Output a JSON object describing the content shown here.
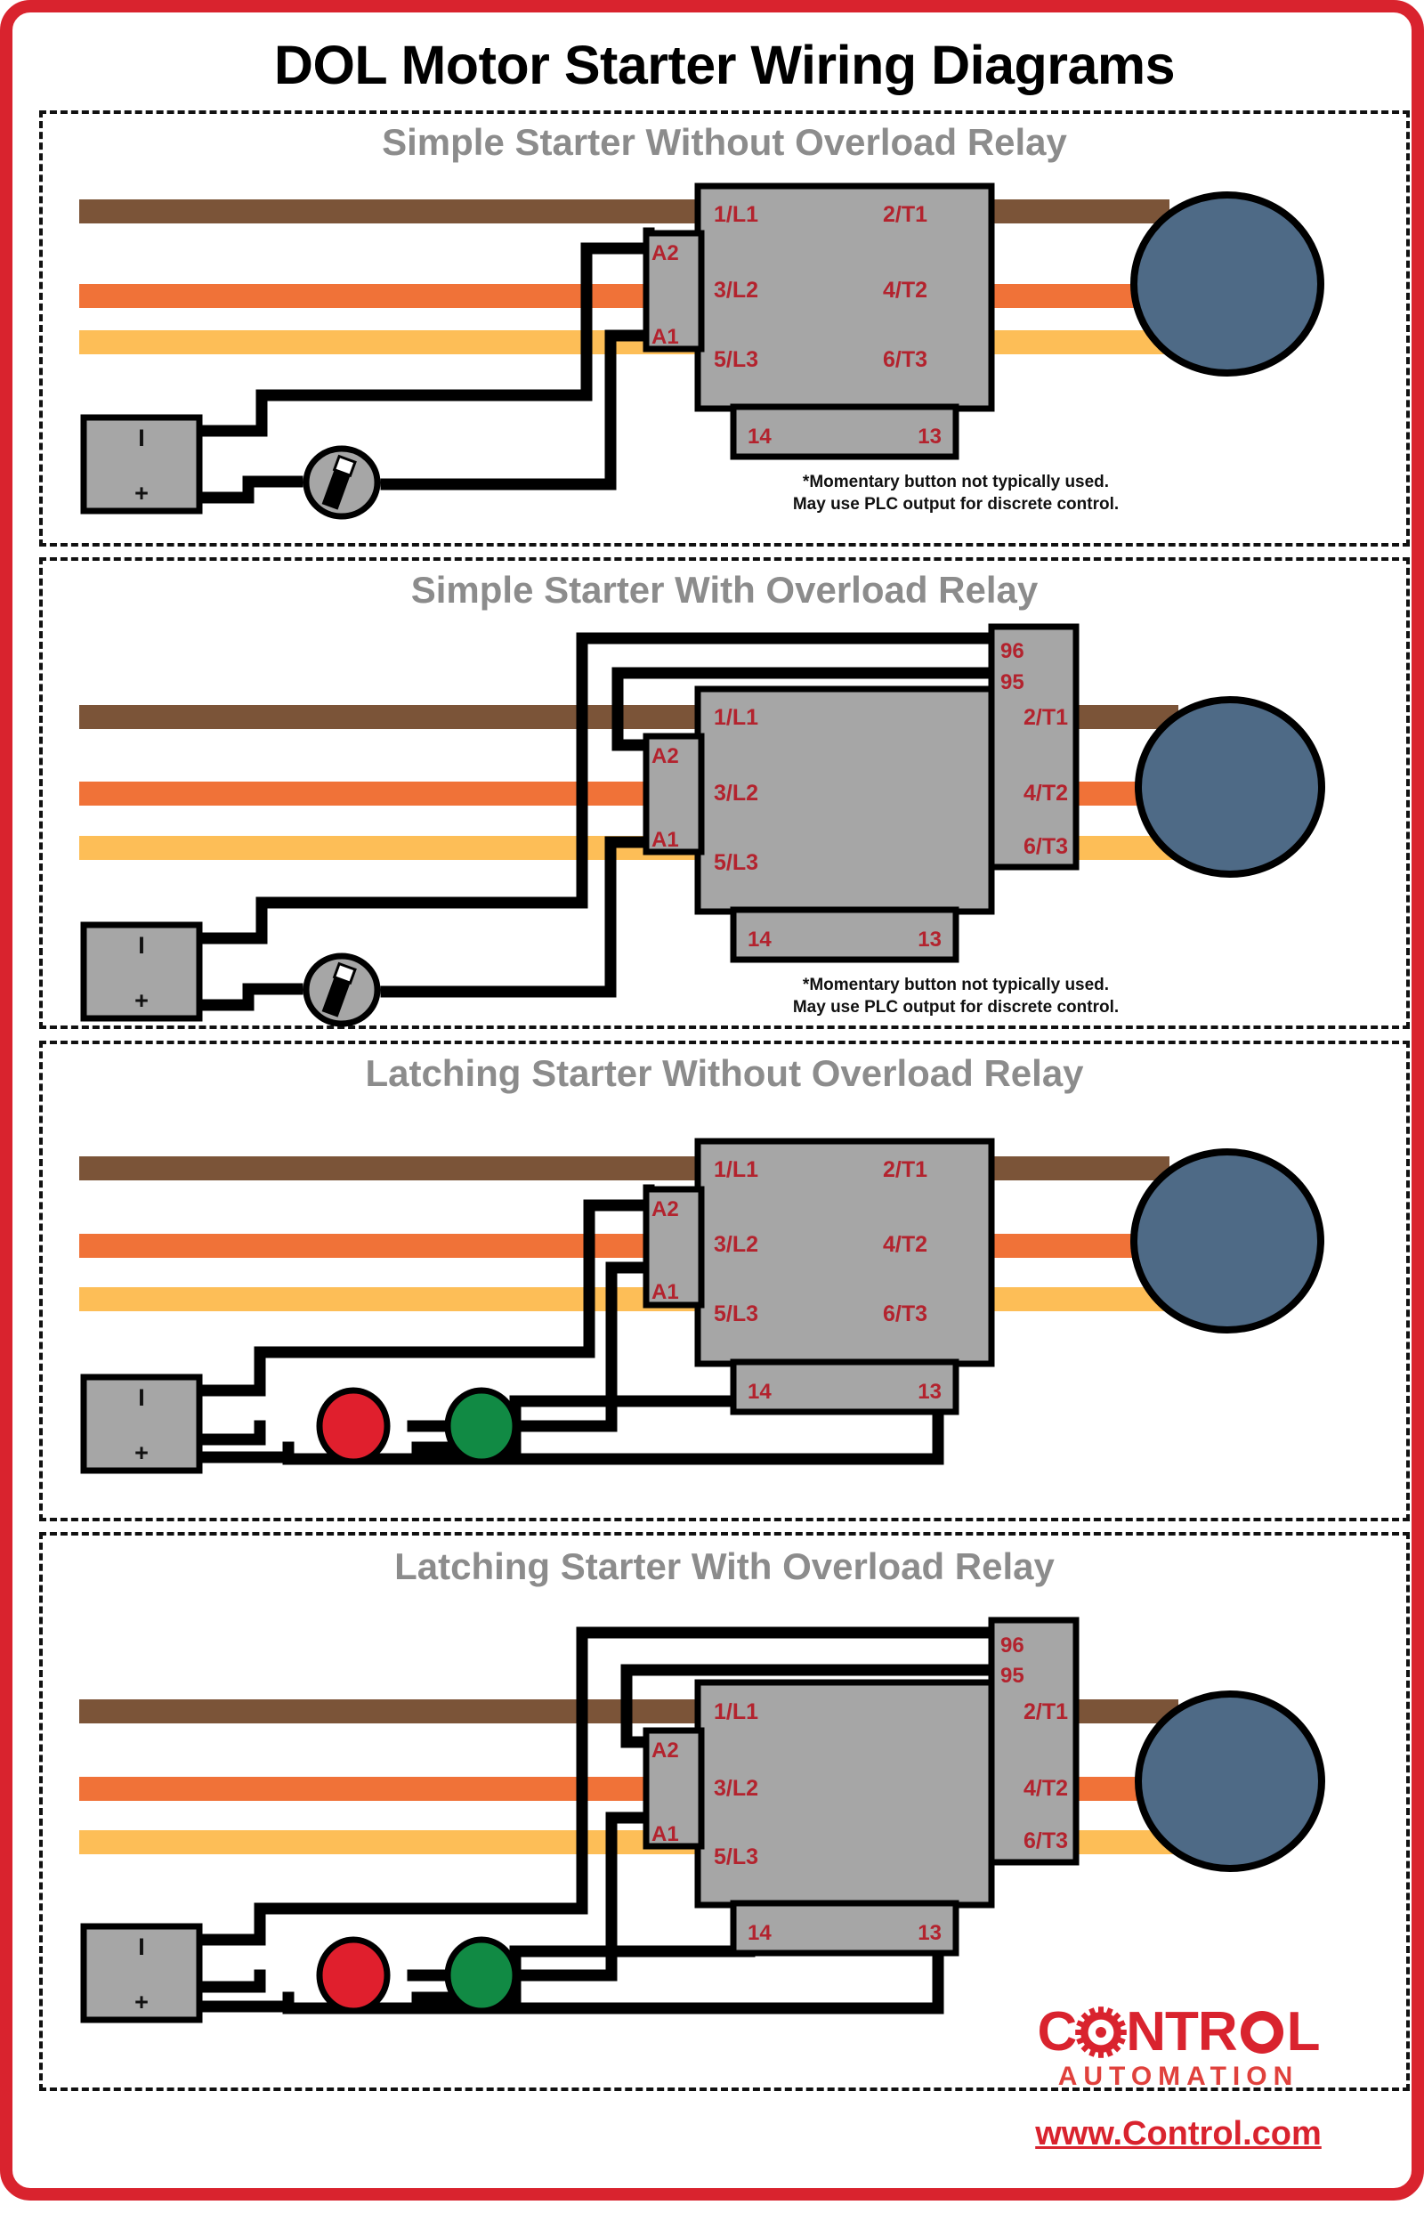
{
  "poster": {
    "title": "DOL Motor Starter Wiring Diagrams",
    "border_color": "#d9232e"
  },
  "colors": {
    "wire_l1_brown": "#7b5438",
    "wire_l2_orange": "#f07238",
    "wire_l3_yellow": "#fdbe57",
    "device_gray": "#a6a6a6",
    "motor_blue": "#4e6a86",
    "terminal_red": "#b3232e",
    "title_gray": "#8c8c8c",
    "stop_button_red": "#e01f2d",
    "start_button_green": "#118a44",
    "wire_black": "#000000"
  },
  "labels": {
    "line_terminals": [
      "1/L1",
      "3/L2",
      "5/L3"
    ],
    "load_terminals": [
      "2/T1",
      "4/T2",
      "6/T3"
    ],
    "coil_terminals": [
      "A2",
      "A1"
    ],
    "aux_terminals": [
      "14",
      "13"
    ],
    "overload_terminals": [
      "96",
      "95"
    ],
    "psu_negative": "I",
    "psu_positive": "+"
  },
  "panels": [
    {
      "id": "p1",
      "title": "Simple Starter Without Overload Relay",
      "has_overload": false,
      "control_type": "momentary",
      "note_line1": "*Momentary button not typically used.",
      "note_line2": "May use PLC output for discrete control."
    },
    {
      "id": "p2",
      "title": "Simple Starter With Overload Relay",
      "has_overload": true,
      "control_type": "momentary",
      "note_line1": "*Momentary button not typically used.",
      "note_line2": "May use PLC output for discrete control."
    },
    {
      "id": "p3",
      "title": "Latching Starter Without Overload Relay",
      "has_overload": false,
      "control_type": "latching",
      "note_line1": "",
      "note_line2": ""
    },
    {
      "id": "p4",
      "title": "Latching Starter With Overload Relay",
      "has_overload": true,
      "control_type": "latching",
      "note_line1": "",
      "note_line2": ""
    }
  ],
  "logo": {
    "word_part_a": "C",
    "word_part_b": "NTR",
    "word_part_c": "L",
    "subtitle": "AUTOMATION",
    "url": "www.Control.com"
  }
}
